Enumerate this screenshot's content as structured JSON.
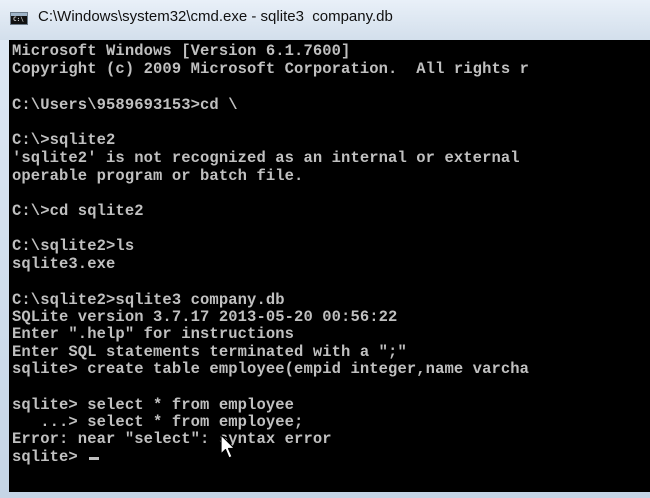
{
  "window": {
    "title": "C:\\Windows\\system32\\cmd.exe - sqlite3  company.db",
    "icon": "cmd-icon",
    "icon_glyph": "C:\\"
  },
  "console": {
    "lines": [
      "Microsoft Windows [Version 6.1.7600]",
      "Copyright (c) 2009 Microsoft Corporation.  All rights r",
      "",
      "C:\\Users\\9589693153>cd \\",
      "",
      "C:\\>sqlite2",
      "'sqlite2' is not recognized as an internal or external",
      "operable program or batch file.",
      "",
      "C:\\>cd sqlite2",
      "",
      "C:\\sqlite2>ls",
      "sqlite3.exe",
      "",
      "C:\\sqlite2>sqlite3 company.db",
      "SQLite version 3.7.17 2013-05-20 00:56:22",
      "Enter \".help\" for instructions",
      "Enter SQL statements terminated with a \";\"",
      "sqlite> create table employee(empid integer,name varcha",
      "",
      "sqlite> select * from employee",
      "   ...> select * from employee;",
      "Error: near \"select\": syntax error",
      "sqlite> "
    ],
    "text_color": "#c0c0c0",
    "background": "#000000"
  }
}
